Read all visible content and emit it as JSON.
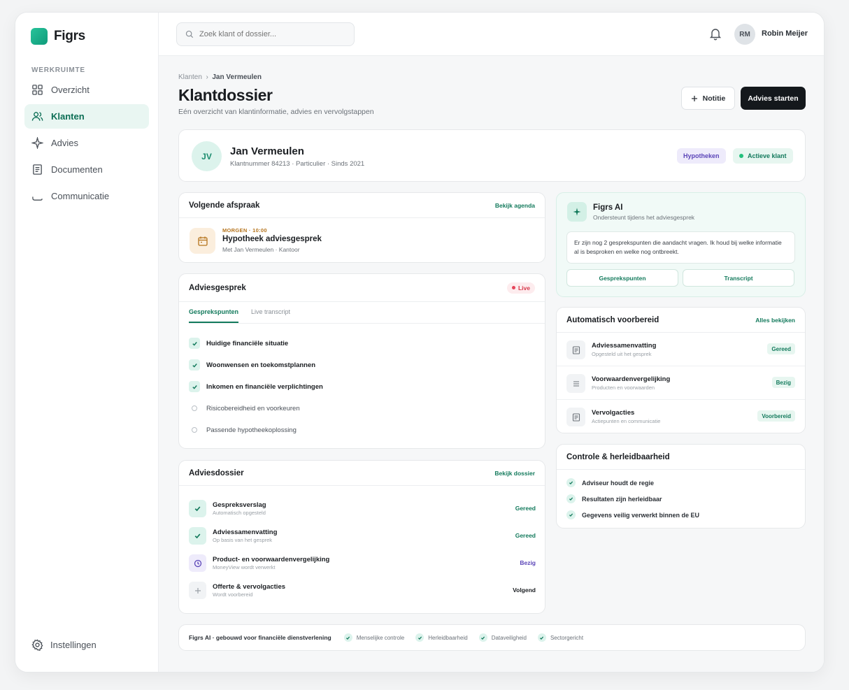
{
  "brand": {
    "name": "Figrs"
  },
  "sidebar": {
    "section_label": "WERKRUIMTE",
    "items": [
      {
        "label": "Overzicht",
        "icon": "grid-icon"
      },
      {
        "label": "Klanten",
        "icon": "users-icon",
        "active": true
      },
      {
        "label": "Advies",
        "icon": "sparkle-icon"
      },
      {
        "label": "Documenten",
        "icon": "document-icon"
      },
      {
        "label": "Communicatie",
        "icon": "chat-icon"
      }
    ],
    "settings_label": "Instellingen"
  },
  "topbar": {
    "search_placeholder": "Zoek klant of dossier...",
    "user_initials": "RM",
    "user_name": "Robin Meijer"
  },
  "page": {
    "breadcrumb_root": "Klanten",
    "breadcrumb_current": "Jan Vermeulen",
    "title": "Klantdossier",
    "subtitle": "Eén overzicht van klantinformatie, advies en vervolgstappen",
    "note_button": "Notitie",
    "start_button": "Advies starten"
  },
  "client": {
    "initials": "JV",
    "name": "Jan Vermeulen",
    "meta": "Klantnummer 84213 · Particulier · Sinds 2021",
    "tag_product": "Hypotheken",
    "tag_status": "Actieve klant"
  },
  "appointment": {
    "title": "Volgende afspraak",
    "link": "Bekijk agenda",
    "when": "MORGEN · 10:00",
    "name": "Hypotheek adviesgesprek",
    "meta": "Met Jan Vermeulen · Kantoor"
  },
  "conversation": {
    "title": "Adviesgesprek",
    "live_label": "Live",
    "tabs": [
      "Gesprekspunten",
      "Live transcript"
    ],
    "points": [
      {
        "label": "Huidige financiële situatie",
        "done": true
      },
      {
        "label": "Woonwensen en toekomstplannen",
        "done": true
      },
      {
        "label": "Inkomen en financiële verplichtingen",
        "done": true
      },
      {
        "label": "Risicobereidheid en voorkeuren",
        "done": false
      },
      {
        "label": "Passende hypotheekoplossing",
        "done": false
      }
    ]
  },
  "dossier": {
    "title": "Adviesdossier",
    "link": "Bekijk dossier",
    "items": [
      {
        "title": "Gespreksverslag",
        "sub": "Automatisch opgesteld",
        "status": "Gereed",
        "icon": "check-icon"
      },
      {
        "title": "Adviessamenvatting",
        "sub": "Op basis van het gesprek",
        "status": "Gereed",
        "icon": "check-icon"
      },
      {
        "title": "Product- en voorwaardenvergelijking",
        "sub": "MoneyView wordt verwerkt",
        "status": "Bezig",
        "icon": "clock-icon"
      },
      {
        "title": "Offerte & vervolgacties",
        "sub": "Wordt voorbereid",
        "status": "Volgend",
        "icon": "plus-icon"
      }
    ],
    "colors": {
      "ready": "#137a5c",
      "busy": "#5b45b8",
      "next": "#1a1d21"
    }
  },
  "ai": {
    "title": "Figrs AI",
    "subtitle": "Ondersteunt tijdens het adviesgesprek",
    "message": "Er zijn nog 2 gesprekspunten die aandacht vragen. Ik houd bij welke informatie al is besproken en welke nog ontbreekt.",
    "button_points": "Gesprekspunten",
    "button_transcript": "Transcript"
  },
  "prep": {
    "title": "Automatisch voorbereid",
    "link": "Alles bekijken",
    "items": [
      {
        "title": "Adviessamenvatting",
        "sub": "Opgesteld uit het gesprek",
        "badge": "Gereed",
        "icon": "document-icon"
      },
      {
        "title": "Voorwaardenvergelijking",
        "sub": "Producten en voorwaarden",
        "badge": "Bezig",
        "icon": "list-icon"
      },
      {
        "title": "Vervolgacties",
        "sub": "Actiepunten en communicatie",
        "badge": "Voorbereid",
        "icon": "document-icon"
      }
    ]
  },
  "control": {
    "title": "Controle & herleidbaarheid",
    "items": [
      "Adviseur houdt de regie",
      "Resultaten zijn herleidbaar",
      "Gegevens veilig verwerkt binnen de EU"
    ]
  },
  "footer": {
    "title": "Figrs AI · gebouwd voor financiële dienstverlening",
    "pills": [
      "Menselijke controle",
      "Herleidbaarheid",
      "Dataveiligheid",
      "Sectorgericht"
    ]
  }
}
